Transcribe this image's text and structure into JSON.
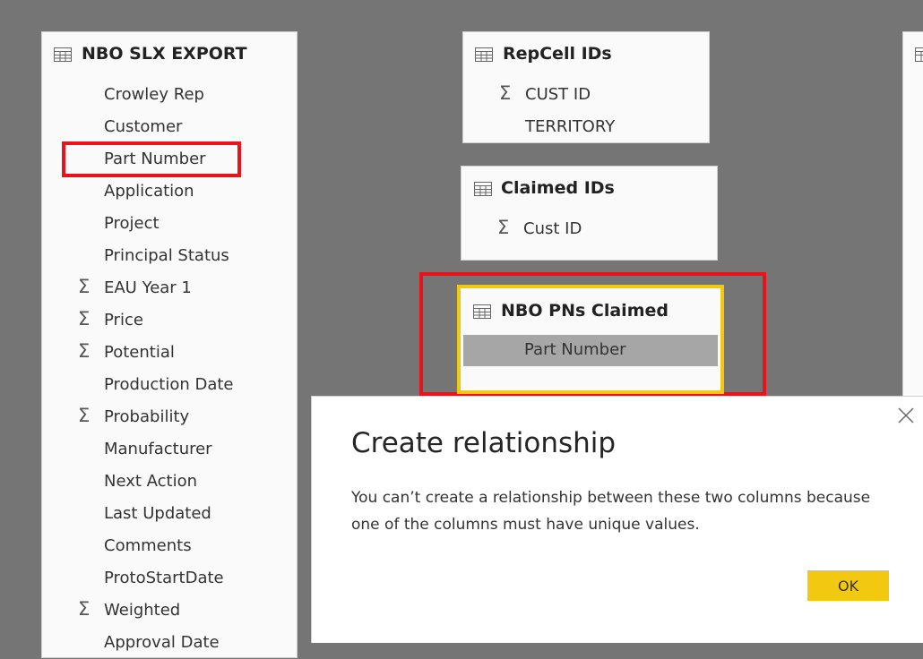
{
  "tables": {
    "nbo_slx_export": {
      "title": "NBO SLX EXPORT",
      "fields": [
        {
          "label": "Crowley Rep",
          "sigma": false
        },
        {
          "label": "Customer",
          "sigma": false
        },
        {
          "label": "Part Number",
          "sigma": false
        },
        {
          "label": "Application",
          "sigma": false
        },
        {
          "label": "Project",
          "sigma": false
        },
        {
          "label": "Principal Status",
          "sigma": false
        },
        {
          "label": "EAU Year 1",
          "sigma": true
        },
        {
          "label": "Price",
          "sigma": true
        },
        {
          "label": "Potential",
          "sigma": true
        },
        {
          "label": "Production Date",
          "sigma": false
        },
        {
          "label": "Probability",
          "sigma": true
        },
        {
          "label": "Manufacturer",
          "sigma": false
        },
        {
          "label": "Next Action",
          "sigma": false
        },
        {
          "label": "Last Updated",
          "sigma": false
        },
        {
          "label": "Comments",
          "sigma": false
        },
        {
          "label": "ProtoStartDate",
          "sigma": false
        },
        {
          "label": "Weighted",
          "sigma": true
        },
        {
          "label": "Approval Date",
          "sigma": false
        }
      ]
    },
    "repcell_ids": {
      "title": "RepCell IDs",
      "fields": [
        {
          "label": "CUST ID",
          "sigma": true
        },
        {
          "label": "TERRITORY",
          "sigma": false
        }
      ]
    },
    "claimed_ids": {
      "title": "Claimed IDs",
      "fields": [
        {
          "label": "Cust ID",
          "sigma": true
        }
      ]
    },
    "nbo_pns_claimed": {
      "title": "NBO PNs Claimed",
      "fields": [
        {
          "label": "Part Number",
          "sigma": false
        }
      ]
    }
  },
  "icons": {
    "table": "table-icon",
    "sigma": "sigma-icon",
    "close": "close-icon"
  },
  "sigma_glyph": "Σ",
  "dialog": {
    "title": "Create relationship",
    "message": "You can’t create a relationship between these two columns because one of the columns must have unique values.",
    "ok_label": "OK"
  },
  "colors": {
    "canvas": "#757575",
    "highlight_red": "#e8141c",
    "selected_yellow": "#f2c811",
    "selected_field": "#a6a6a6"
  }
}
